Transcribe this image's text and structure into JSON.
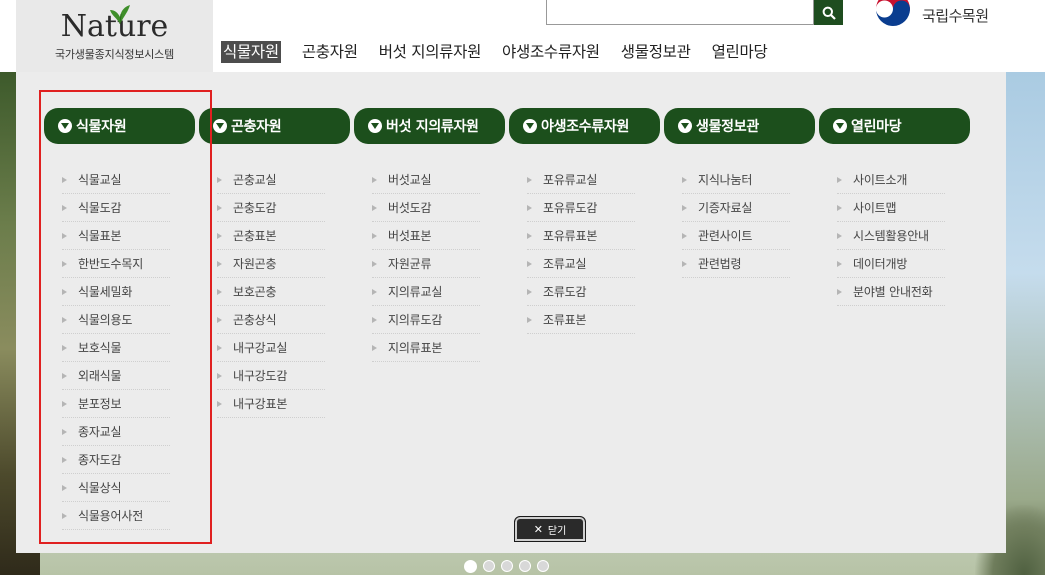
{
  "header": {
    "logo_word": "Nature",
    "logo_subtitle": "국가생물종지식정보시스템",
    "search": {
      "value": "",
      "placeholder": ""
    },
    "org_name": "국립수목원"
  },
  "gnb": [
    {
      "label": "식물자원",
      "active": true
    },
    {
      "label": "곤충자원",
      "active": false
    },
    {
      "label": "버섯 지의류자원",
      "active": false
    },
    {
      "label": "야생조수류자원",
      "active": false
    },
    {
      "label": "생물정보관",
      "active": false
    },
    {
      "label": "열린마당",
      "active": false
    }
  ],
  "menu_columns": [
    {
      "title": "식물자원",
      "items": [
        "식물교실",
        "식물도감",
        "식물표본",
        "한반도수목지",
        "식물세밀화",
        "식물의용도",
        "보호식물",
        "외래식물",
        "분포정보",
        "종자교실",
        "종자도감",
        "식물상식",
        "식물용어사전"
      ]
    },
    {
      "title": "곤충자원",
      "items": [
        "곤충교실",
        "곤충도감",
        "곤충표본",
        "자원곤충",
        "보호곤충",
        "곤충상식",
        "내구강교실",
        "내구강도감",
        "내구강표본"
      ]
    },
    {
      "title": "버섯 지의류자원",
      "items": [
        "버섯교실",
        "버섯도감",
        "버섯표본",
        "자원균류",
        "지의류교실",
        "지의류도감",
        "지의류표본"
      ]
    },
    {
      "title": "야생조수류자원",
      "items": [
        "포유류교실",
        "포유류도감",
        "포유류표본",
        "조류교실",
        "조류도감",
        "조류표본"
      ]
    },
    {
      "title": "생물정보관",
      "items": [
        "지식나눔터",
        "기증자료실",
        "관련사이트",
        "관련법령"
      ]
    },
    {
      "title": "열린마당",
      "items": [
        "사이트소개",
        "사이트맵",
        "시스템활용안내",
        "데이터개방",
        "분야별 안내전화"
      ]
    }
  ],
  "close_label": "닫기",
  "slider_dots": [
    true,
    false,
    false,
    false,
    false
  ],
  "colors": {
    "menu_head": "#1c4f1c",
    "search_button": "#1e4d1f",
    "highlight": "#e02020"
  }
}
